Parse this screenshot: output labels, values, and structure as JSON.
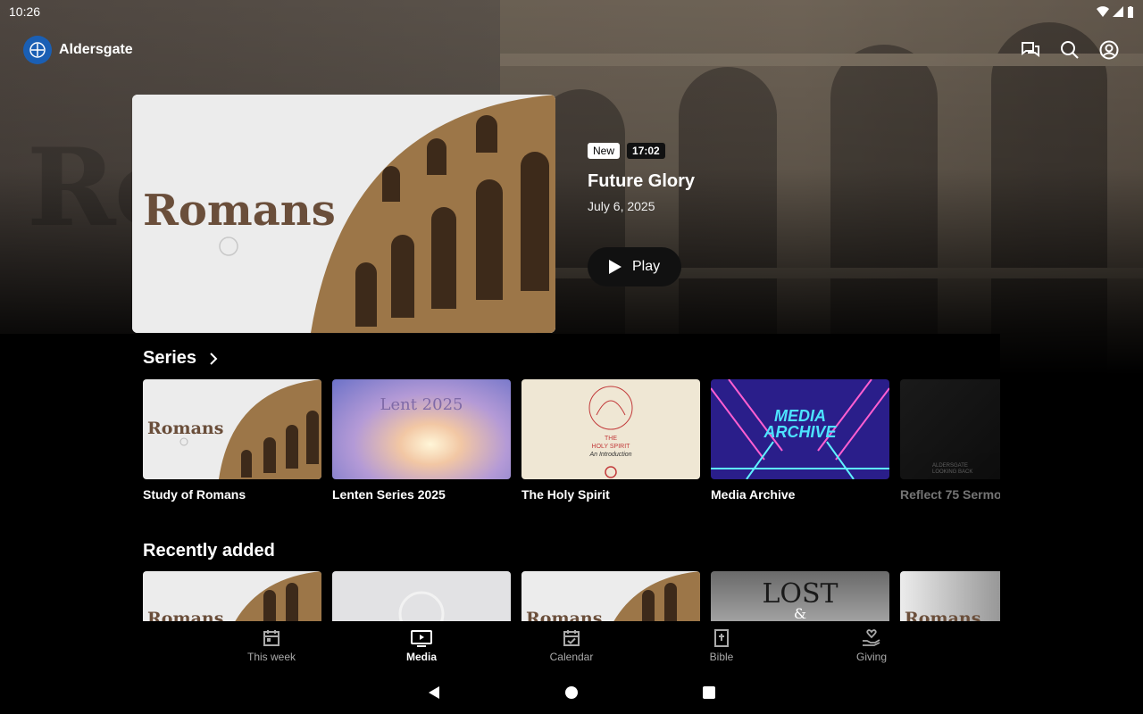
{
  "status": {
    "time": "10:26"
  },
  "app": {
    "name": "Aldersgate"
  },
  "background": {
    "word": "Ro"
  },
  "feature": {
    "art_title": "Romans",
    "badge_new": "New",
    "duration": "17:02",
    "title": "Future Glory",
    "date": "July 6, 2025",
    "play_label": "Play"
  },
  "series": {
    "heading": "Series",
    "items": [
      {
        "label": "Study of Romans",
        "art": "Romans"
      },
      {
        "label": "Lenten Series 2025",
        "art": "Lent 2025"
      },
      {
        "label": "The Holy Spirit",
        "art_line1": "THE",
        "art_line2": "HOLY SPIRIT",
        "art_line3": "An Introduction"
      },
      {
        "label": "Media Archive",
        "art_line1": "MEDIA",
        "art_line2": "ARCHIVE"
      },
      {
        "label": "Reflect 75 Sermo",
        "art_line1": "ALDERSGATE",
        "art_line2": "LOOKING BACK"
      }
    ]
  },
  "recent": {
    "heading": "Recently added",
    "items": [
      {
        "art": "Romans"
      },
      {
        "art": ""
      },
      {
        "art": "Romans"
      },
      {
        "art": "LOST",
        "art2": "&"
      },
      {
        "art": "Romans"
      }
    ]
  },
  "nav": {
    "items": [
      {
        "label": "This week",
        "icon": "calendar-icon"
      },
      {
        "label": "Media",
        "icon": "media-icon"
      },
      {
        "label": "Calendar",
        "icon": "calendar-check-icon"
      },
      {
        "label": "Bible",
        "icon": "bible-icon"
      },
      {
        "label": "Giving",
        "icon": "giving-icon"
      }
    ],
    "active": "Media"
  },
  "colors": {
    "brand": "#1a5fb4",
    "background": "#000000"
  }
}
